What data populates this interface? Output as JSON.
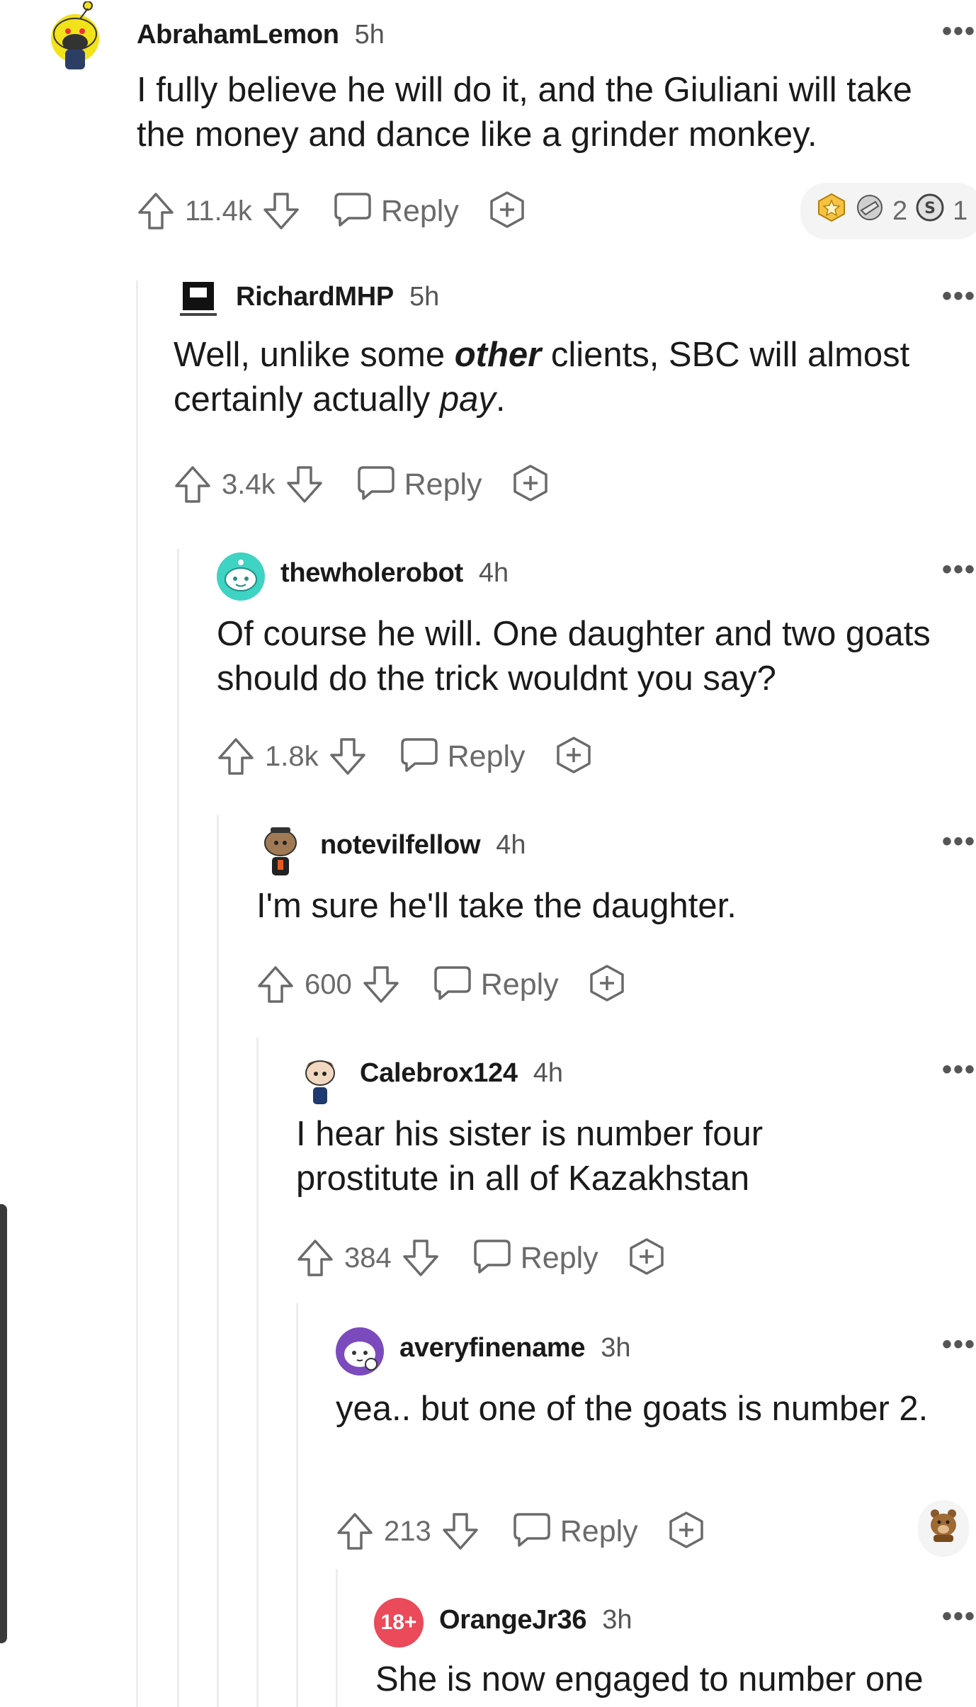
{
  "comments": [
    {
      "username": "AbrahamLemon",
      "time": "5h",
      "body": "I fully believe he will do it, and the Giuliani will take the money and dance like a grinder monkey.",
      "votes": "11.4k",
      "reply_label": "Reply",
      "awards": {
        "count_a": "2",
        "count_b": "1"
      }
    },
    {
      "username": "RichardMHP",
      "time": "5h",
      "body_parts": [
        "Well, unlike some ",
        "other",
        " clients, SBC will almost certainly actually ",
        "pay",
        "."
      ],
      "votes": "3.4k",
      "reply_label": "Reply"
    },
    {
      "username": "thewholerobot",
      "time": "4h",
      "body": "Of course he will. One daughter and two goats should do the trick wouldnt you say?",
      "votes": "1.8k",
      "reply_label": "Reply"
    },
    {
      "username": "notevilfellow",
      "time": "4h",
      "body": "I'm sure he'll take the daughter.",
      "votes": "600",
      "reply_label": "Reply"
    },
    {
      "username": "Calebrox124",
      "time": "4h",
      "body": "I hear his sister is number four prostitute in all of Kazakhstan",
      "votes": "384",
      "reply_label": "Reply"
    },
    {
      "username": "averyfinename",
      "time": "3h",
      "body": "yea.. but one of the goats is number 2.",
      "votes": "213",
      "reply_label": "Reply"
    },
    {
      "username": "OrangeJr36",
      "time": "3h",
      "badge": "18+",
      "body": "She is now engaged to number one"
    }
  ],
  "colors": {
    "text": "#1a1a1b",
    "muted": "#6a6a6a",
    "thread_line": "#ededed",
    "nsfw": "#ea4a5a",
    "snoo_yellow": "#f2e21a",
    "robot_teal": "#3ed3c3",
    "purple": "#7b4bbd"
  },
  "icons": [
    "upvote-icon",
    "downvote-icon",
    "reply-bubble-icon",
    "award-plus-icon",
    "more-options-icon"
  ]
}
